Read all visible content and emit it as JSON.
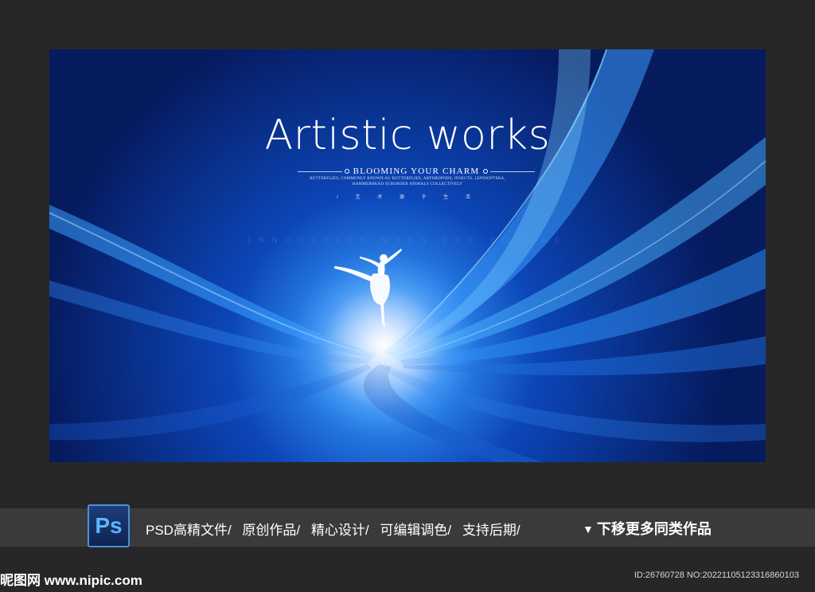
{
  "poster": {
    "title": "Artistic works",
    "subtitle": "BLOOMING YOUR CHARM",
    "desc_line1": "BUTTERFLIES, COMMONLY KNOWN AS 'BUTTERFLIES, ARTHROPODS, INSECTS, LEPIDOPTERA,",
    "desc_line2": "HAMMERHEAD SUBORDER ANIMALS COLLECTIVELY",
    "cn_line": "/ 艺 术 源 于 生 活",
    "faint_text": "INNOVATION WINS THE FUTURE",
    "colors": {
      "deep": "#061a5e",
      "mid": "#0b3fb0",
      "bright": "#3fa0ff",
      "glow": "#e8f2ff"
    }
  },
  "footer": {
    "ps_icon_label": "Ps",
    "features": [
      "PSD高精文件/",
      "原创作品/",
      "精心设计/",
      "可编辑调色/",
      "支持后期/"
    ],
    "more_label": "下移更多同类作品",
    "more_icon": "triangle-down-icon",
    "watermark": "昵图网 www.nipic.com",
    "id_info": "ID:26760728 NO:20221105123316860103"
  }
}
